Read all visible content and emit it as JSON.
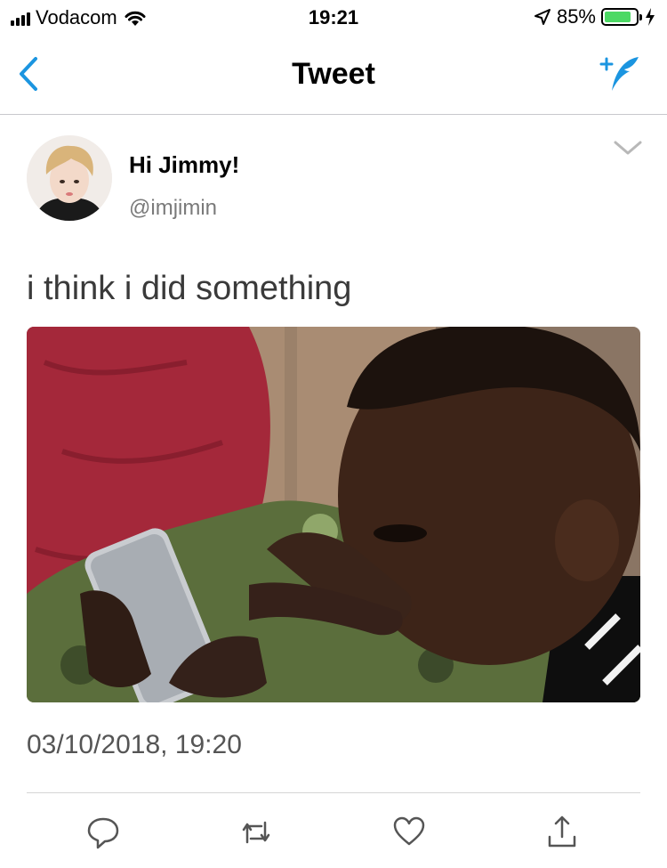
{
  "status_bar": {
    "carrier": "Vodacom",
    "time": "19:21",
    "battery_percent": "85%",
    "battery_level": 0.85,
    "icons": [
      "signal-bars-icon",
      "wifi-icon",
      "location-arrow-icon",
      "battery-icon",
      "charging-bolt-icon"
    ]
  },
  "nav": {
    "title": "Tweet",
    "back_icon": "chevron-left-icon",
    "compose_icon": "compose-tweet-icon",
    "accent_color": "#1da1f2"
  },
  "tweet": {
    "display_name": "Hi Jimmy!",
    "handle": "@imjimin",
    "text": "i think i did something",
    "timestamp": "03/10/2018, 19:20",
    "menu_icon": "chevron-down-icon",
    "actions": [
      "reply-icon",
      "retweet-icon",
      "like-icon",
      "share-icon"
    ]
  },
  "colors": {
    "text": "#000000",
    "secondary_text": "#7a7a7a",
    "divider": "#d5d5d5",
    "icon_blue": "#1b95e0",
    "battery_green": "#4cd964"
  }
}
